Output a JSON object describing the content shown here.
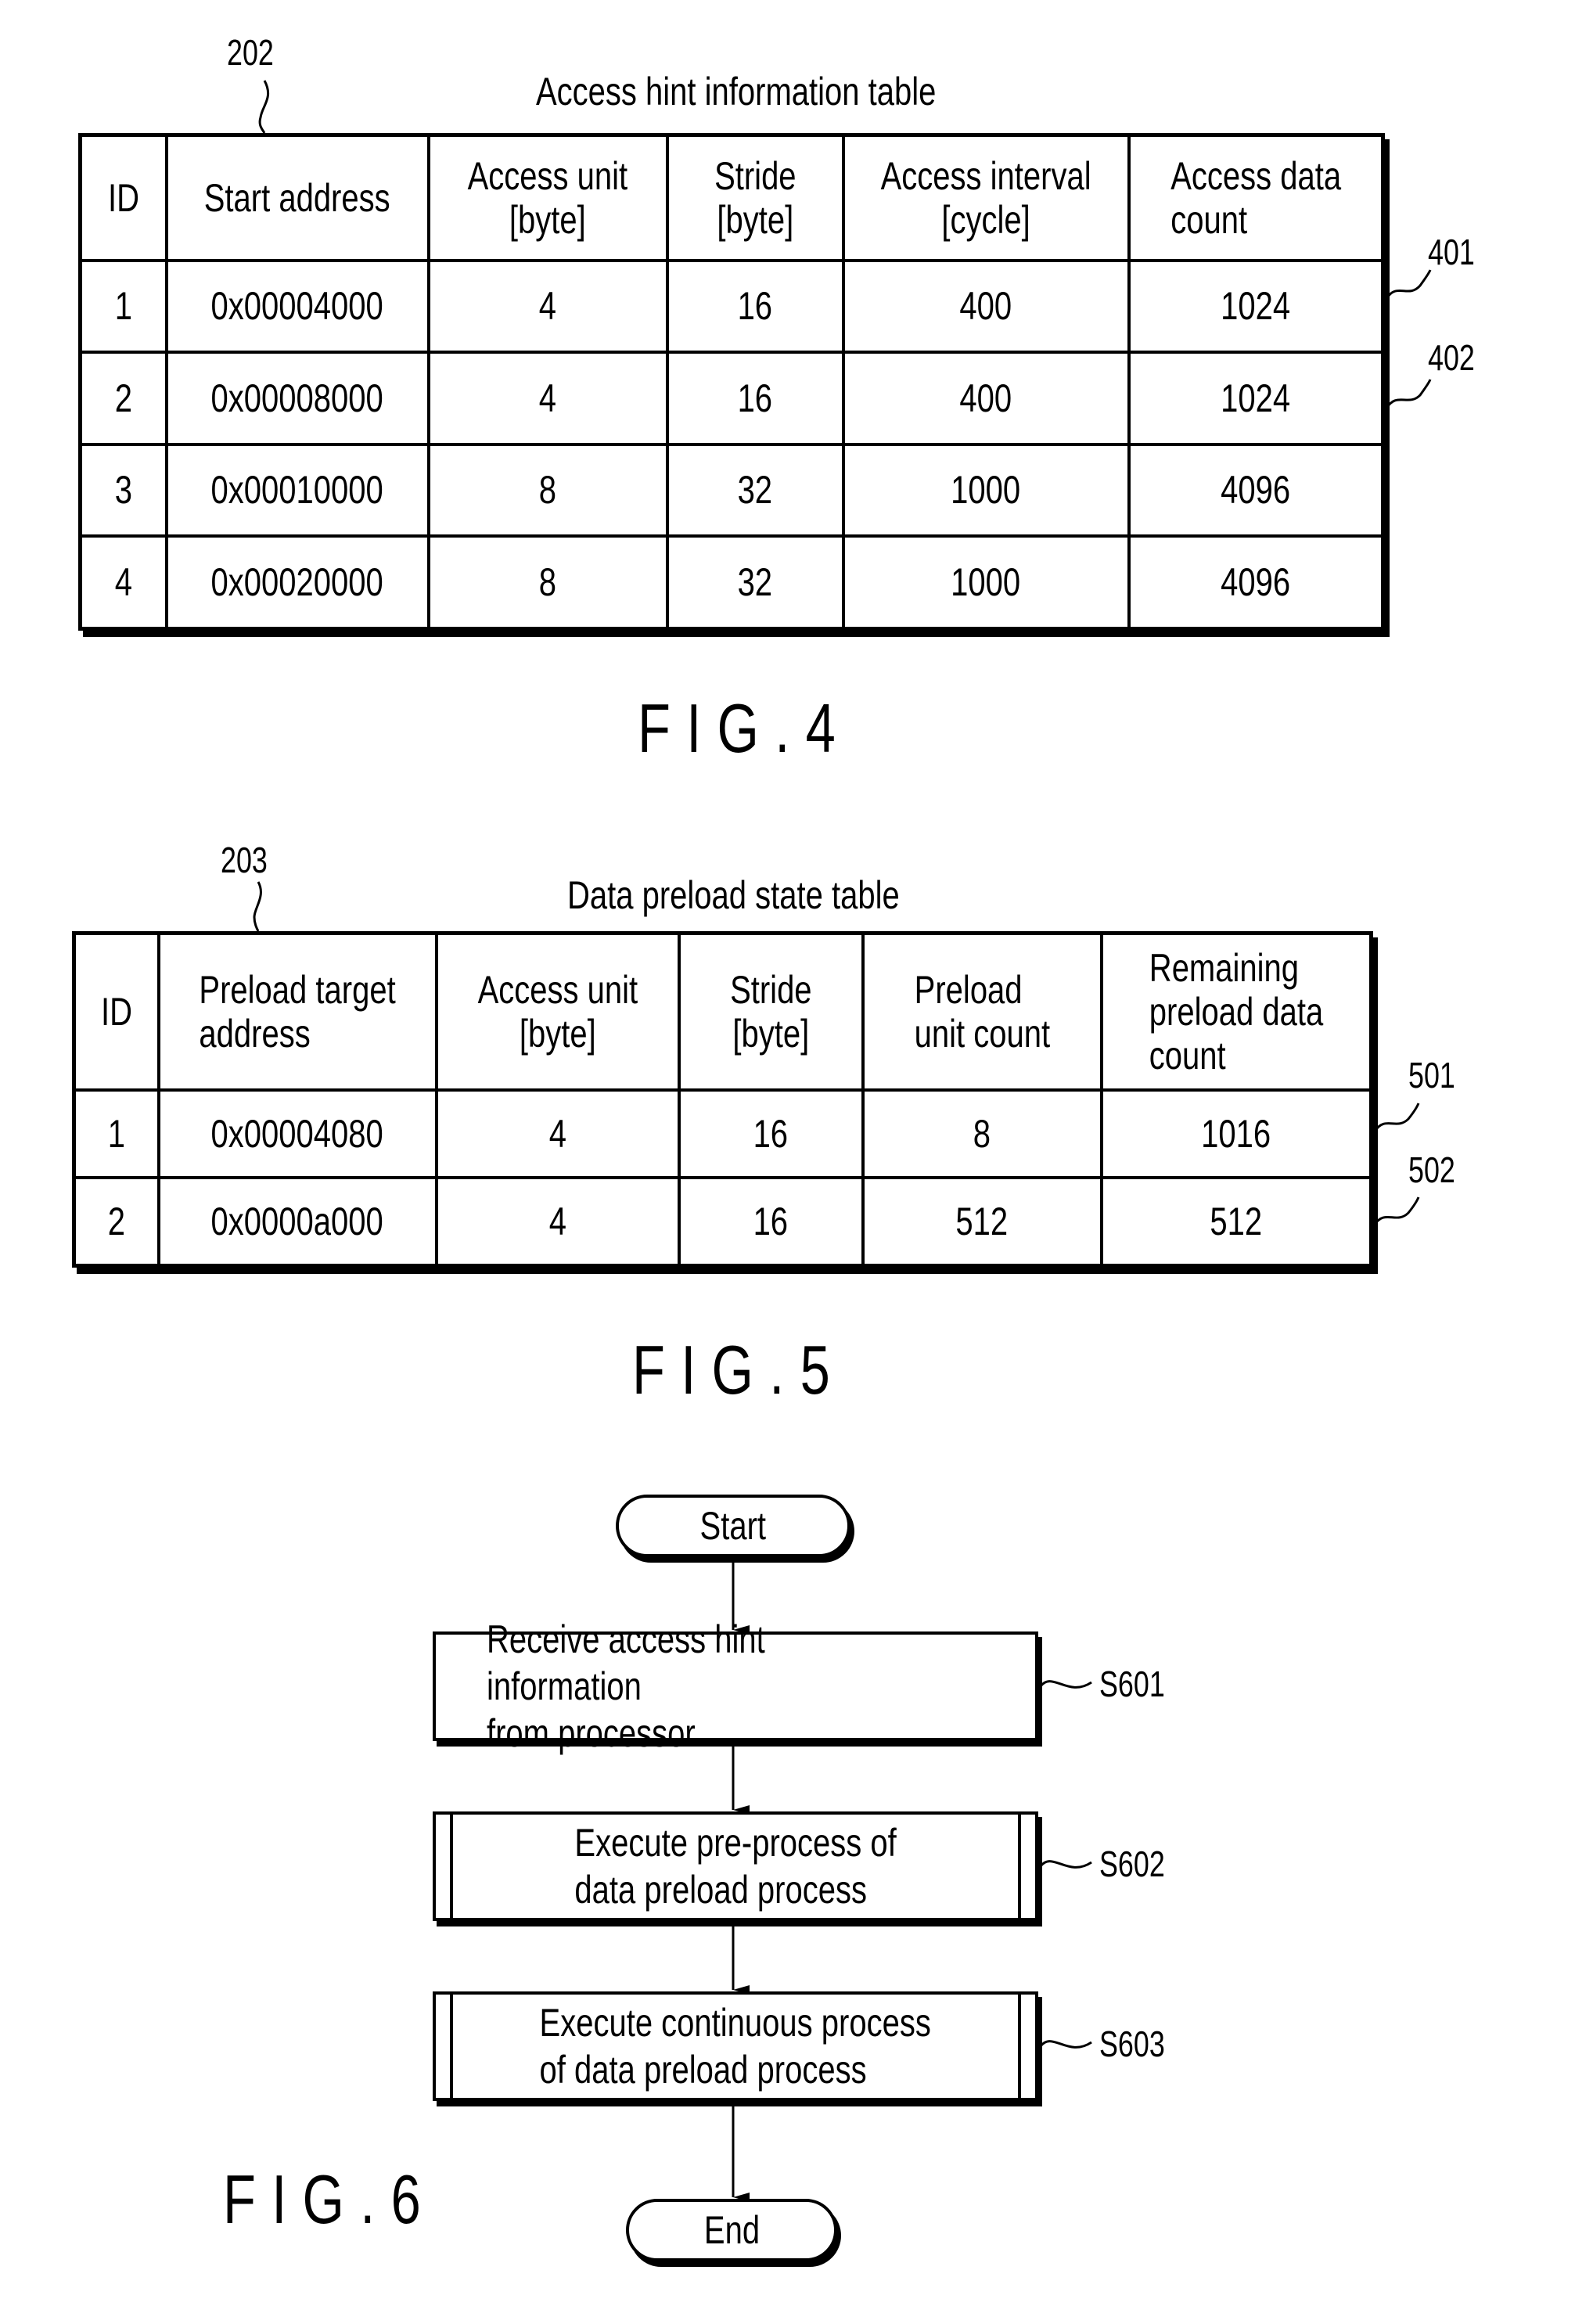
{
  "fig4": {
    "ref_label": "202",
    "title": "Access hint information table",
    "columns": [
      "ID",
      "Start address",
      "Access unit\n[byte]",
      "Stride\n[byte]",
      "Access interval\n[cycle]",
      "Access data\ncount"
    ],
    "rows": [
      [
        "1",
        "0x00004000",
        "4",
        "16",
        "400",
        "1024"
      ],
      [
        "2",
        "0x00008000",
        "4",
        "16",
        "400",
        "1024"
      ],
      [
        "3",
        "0x00010000",
        "8",
        "32",
        "1000",
        "4096"
      ],
      [
        "4",
        "0x00020000",
        "8",
        "32",
        "1000",
        "4096"
      ]
    ],
    "row_refs": [
      "401",
      "402"
    ],
    "caption": "FIG.4"
  },
  "fig5": {
    "ref_label": "203",
    "title": "Data preload state table",
    "columns": [
      "ID",
      "Preload target\naddress",
      "Access unit\n[byte]",
      "Stride\n[byte]",
      "Preload\nunit count",
      "Remaining\npreload data\ncount"
    ],
    "rows": [
      [
        "1",
        "0x00004080",
        "4",
        "16",
        "8",
        "1016"
      ],
      [
        "2",
        "0x0000a000",
        "4",
        "16",
        "512",
        "512"
      ]
    ],
    "row_refs": [
      "501",
      "502"
    ],
    "caption": "FIG.5"
  },
  "fig6": {
    "start": "Start",
    "steps": [
      {
        "text": "Receive access hint information\nfrom processor",
        "ref": "S601",
        "type": "process"
      },
      {
        "text": "Execute pre-process of\ndata preload process",
        "ref": "S602",
        "type": "subroutine"
      },
      {
        "text": "Execute continuous process\nof data preload process",
        "ref": "S603",
        "type": "subroutine"
      }
    ],
    "end": "End",
    "caption": "FIG.6"
  }
}
